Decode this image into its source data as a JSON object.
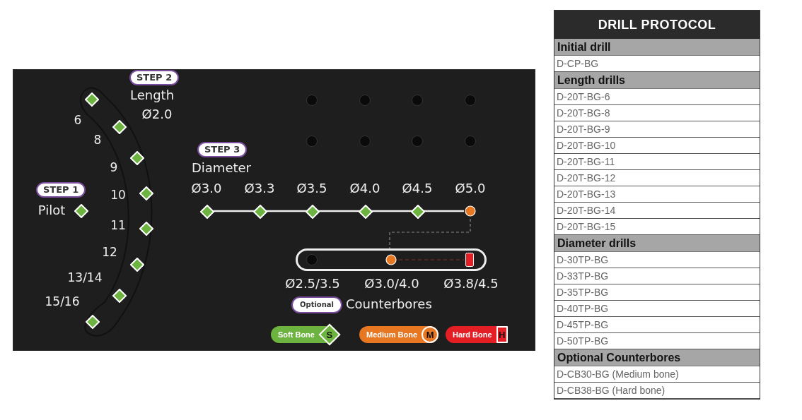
{
  "tray": {
    "step_1": {
      "badge": "STEP 1",
      "label": "Pilot",
      "marker": {
        "kind": "soft"
      }
    },
    "step_2": {
      "badge": "STEP 2",
      "title": "Length",
      "diameter": "Ø2.0",
      "slots": [
        {
          "kind": "soft",
          "label": "6"
        },
        {
          "kind": "soft",
          "label": "8"
        },
        {
          "kind": "soft",
          "label": "9"
        },
        {
          "kind": "soft",
          "label": "10"
        },
        {
          "kind": "soft",
          "label": "11"
        },
        {
          "kind": "soft",
          "label": "12"
        },
        {
          "kind": "soft",
          "label": "13/14"
        },
        {
          "kind": "soft",
          "label": "15/16"
        }
      ]
    },
    "step_3": {
      "badge": "STEP 3",
      "title": "Diameter",
      "slots": [
        {
          "kind": "soft",
          "label": "Ø3.0"
        },
        {
          "kind": "soft",
          "label": "Ø3.3"
        },
        {
          "kind": "soft",
          "label": "Ø3.5"
        },
        {
          "kind": "soft",
          "label": "Ø4.0"
        },
        {
          "kind": "soft",
          "label": "Ø4.5"
        },
        {
          "kind": "medium",
          "label": "Ø5.0"
        }
      ]
    },
    "counterbores": {
      "badge": "Optional",
      "title": "Counterbores",
      "slots": [
        {
          "kind": "empty",
          "label": "Ø2.5/3.5"
        },
        {
          "kind": "medium",
          "label": "Ø3.0/4.0"
        },
        {
          "kind": "hard",
          "label": "Ø3.8/4.5"
        }
      ]
    },
    "legend": [
      {
        "kind": "soft",
        "label": "Soft Bone",
        "symbol": "S"
      },
      {
        "kind": "medium",
        "label": "Medium Bone",
        "symbol": "M"
      },
      {
        "kind": "hard",
        "label": "Hard Bone",
        "symbol": "H"
      }
    ]
  },
  "drill_protocol": {
    "title": "DRILL PROTOCOL",
    "sections": [
      {
        "heading": "Initial drill",
        "items": [
          "D-CP-BG"
        ]
      },
      {
        "heading": "Length drills",
        "items": [
          "D-20T-BG-6",
          "D-20T-BG-8",
          "D-20T-BG-9",
          "D-20T-BG-10",
          "D-20T-BG-11",
          "D-20T-BG-12",
          "D-20T-BG-13",
          "D-20T-BG-14",
          "D-20T-BG-15"
        ]
      },
      {
        "heading": "Diameter drills",
        "items": [
          "D-30TP-BG",
          "D-33TP-BG",
          "D-35TP-BG",
          "D-40TP-BG",
          "D-45TP-BG",
          "D-50TP-BG"
        ]
      },
      {
        "heading": "Optional Counterbores",
        "items": [
          "D-CB30-BG (Medium bone)",
          "D-CB38-BG (Hard bone)"
        ]
      }
    ]
  }
}
